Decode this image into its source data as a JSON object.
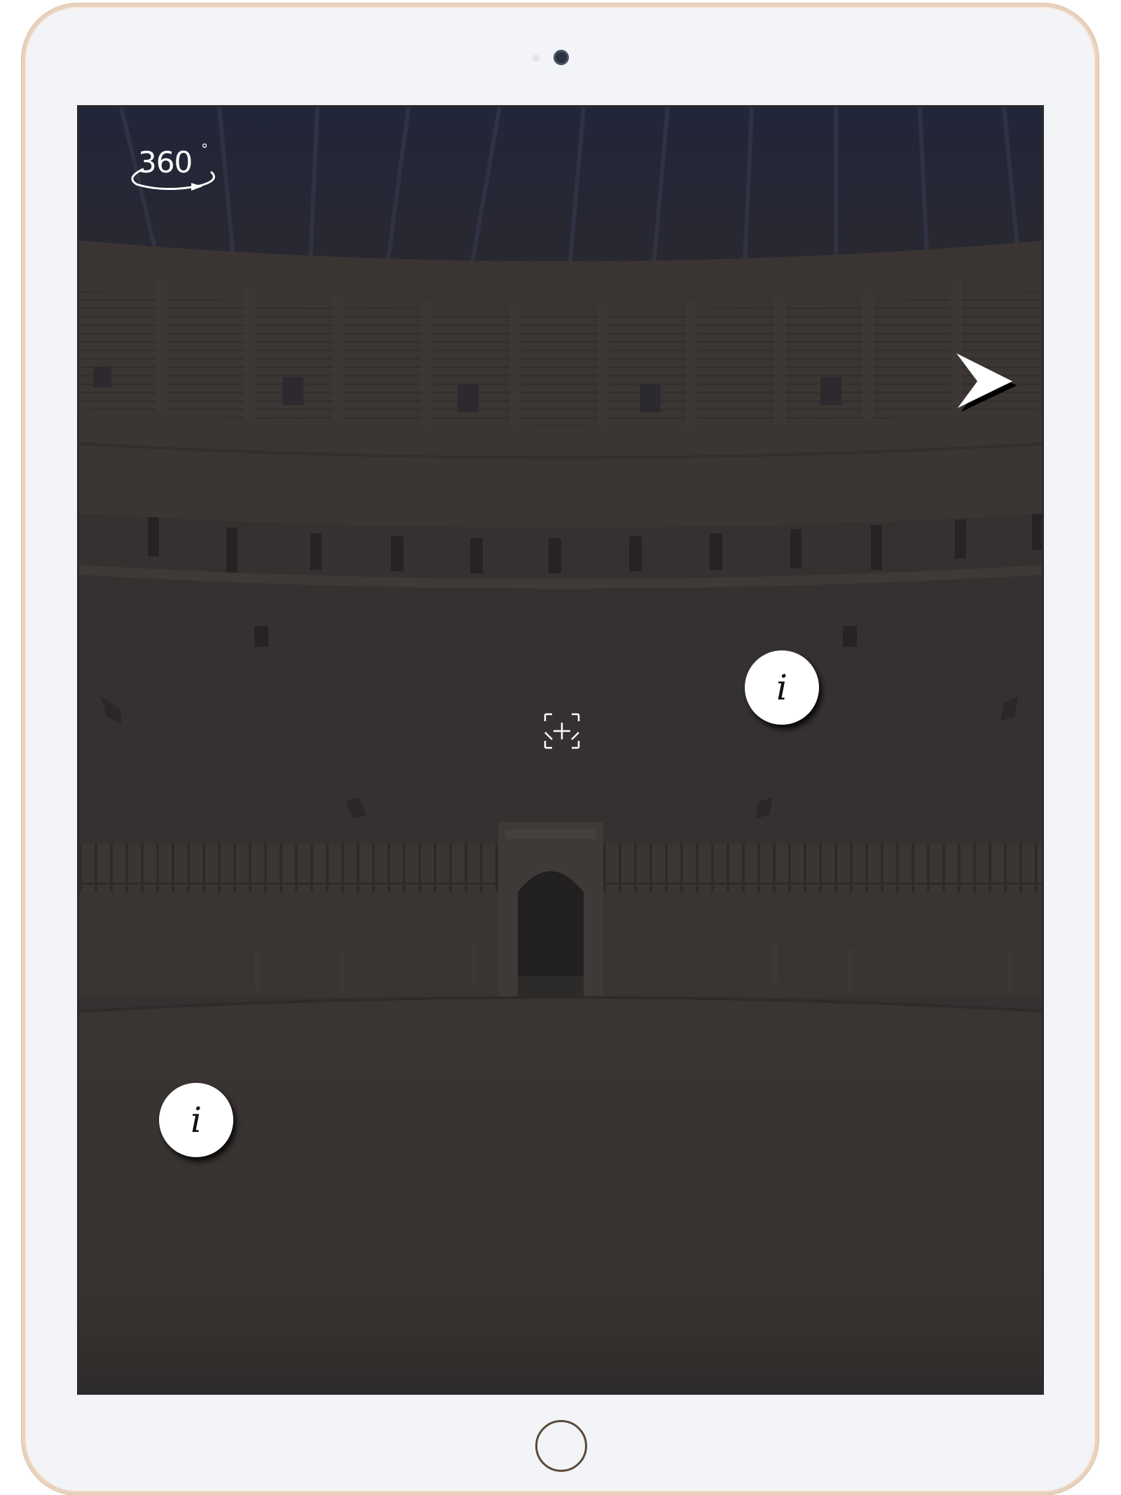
{
  "device": {
    "type": "tablet"
  },
  "viewer": {
    "badge": {
      "text": "360",
      "degree_symbol": "°",
      "icon": "360-rotate-icon"
    },
    "next_icon": "chevron-right-icon",
    "vr_icon": "vr-headset-icon",
    "info_hotspots": [
      {
        "label": "i",
        "icon": "info-icon"
      },
      {
        "label": "i",
        "icon": "info-icon"
      }
    ]
  },
  "colors": {
    "screen_bg": "#353131",
    "frame": "#f2f4f8",
    "frame_edge": "#e9d2bd",
    "hotspot": "#ffffff"
  }
}
